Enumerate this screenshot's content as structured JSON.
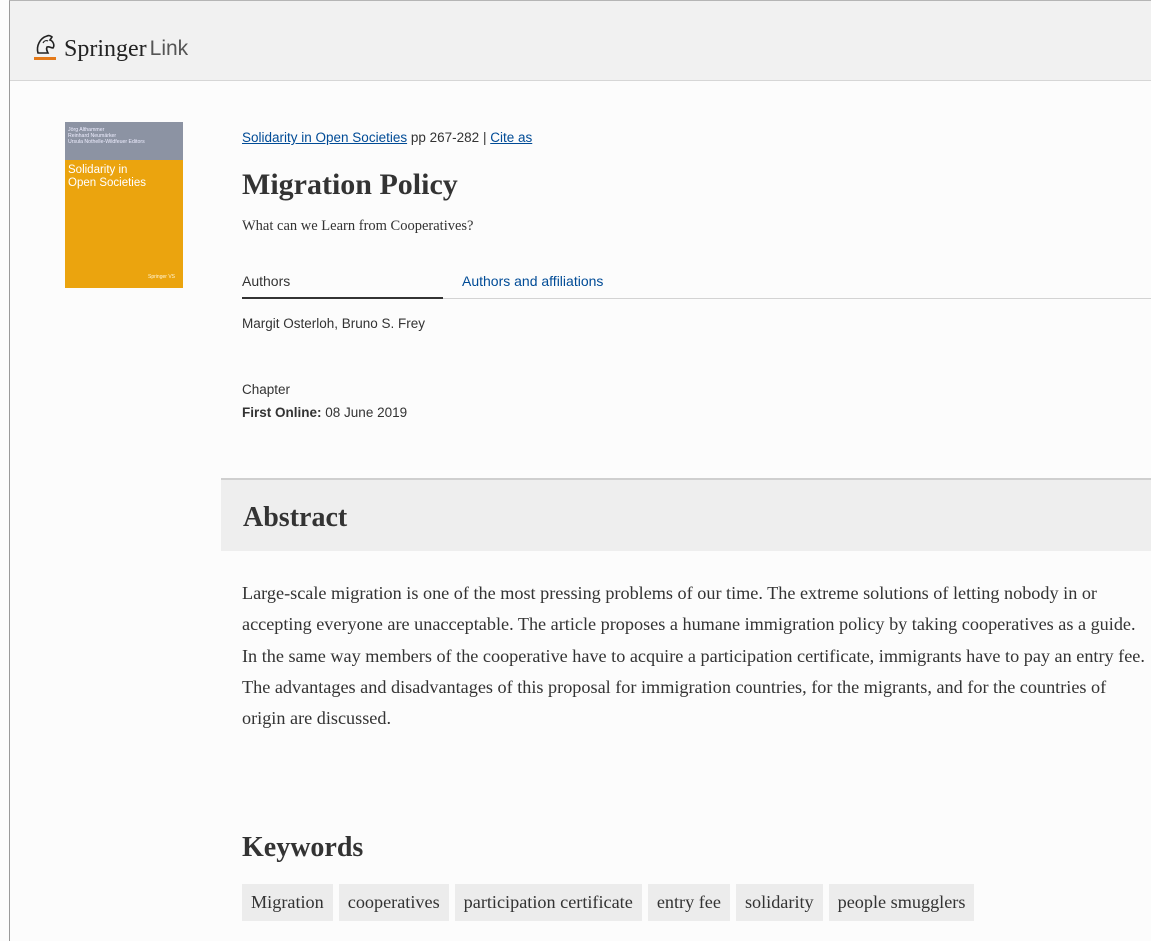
{
  "header": {
    "brand_primary": "Springer",
    "brand_secondary": "Link",
    "logo_icon": "horse-head-icon",
    "brand_color": "#e47a1a"
  },
  "cover": {
    "editors": [
      "Jörg Althammer",
      "Reinhard Neumärker",
      "Ursula Nothelle-Wildfeuer  Editors"
    ],
    "title_line1": "Solidarity in",
    "title_line2": "Open Societies",
    "publisher": "Springer VS",
    "color": "#eba40e"
  },
  "chapter": {
    "book_title": "Solidarity in Open Societies",
    "pages": "pp 267-282",
    "separator": "|",
    "cite_label": "Cite as",
    "title": "Migration Policy",
    "subtitle": "What can we Learn from Cooperatives?",
    "tabs": {
      "authors": "Authors",
      "affiliations": "Authors and affiliations"
    },
    "authors": "Margit Osterloh, Bruno S. Frey",
    "type": "Chapter",
    "first_online_label": "First Online:",
    "first_online_date": "08 June 2019"
  },
  "abstract": {
    "heading": "Abstract",
    "text": "Large-scale migration is one of the most pressing problems of our time. The extreme solutions of letting nobody in or accepting everyone are unacceptable. The article proposes a humane immigration policy by taking cooperatives as a guide. In the same way members of the cooperative have to acquire a participation certificate, immigrants have to pay an entry fee. The advantages and disadvantages of this proposal for immigration countries, for the migrants, and for the countries of origin are discussed."
  },
  "keywords": {
    "heading": "Keywords",
    "items": [
      "Migration",
      "cooperatives",
      "participation certificate",
      "entry fee",
      "solidarity",
      "people smugglers"
    ]
  }
}
